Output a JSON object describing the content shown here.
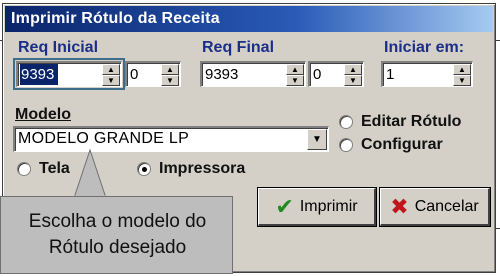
{
  "dialog": {
    "title": "Imprimir Rótulo da Receita"
  },
  "req_inicial": {
    "label": "Req Inicial",
    "value": "9393",
    "suffix_value": "0"
  },
  "req_final": {
    "label": "Req Final",
    "value": "9393",
    "suffix_value": "0"
  },
  "iniciar_em": {
    "label": "Iniciar em:",
    "value": "1"
  },
  "modelo": {
    "label": "Modelo",
    "selected": "MODELO GRANDE LP"
  },
  "options": {
    "editar_rotulo": "Editar Rótulo",
    "configurar": "Configurar"
  },
  "output": {
    "tela": "Tela",
    "impressora": "Impressora",
    "selected": "impressora"
  },
  "buttons": {
    "imprimir": "Imprimir",
    "cancelar": "Cancelar"
  },
  "callout": {
    "line1": "Escolha o modelo do",
    "line2": "Rótulo desejado"
  },
  "colors": {
    "title_bar": "#0a246a",
    "label_blue": "#1b2f86",
    "selection": "#0a246a",
    "check_icon": "#1f8a1f",
    "cancel_icon": "#c0161b",
    "callout_bg": "#bdbdbd"
  },
  "icons": {
    "spin": "spin-updown-icon",
    "combo": "chevron-down-icon",
    "imprimir": "check-icon",
    "cancelar": "x-icon"
  }
}
